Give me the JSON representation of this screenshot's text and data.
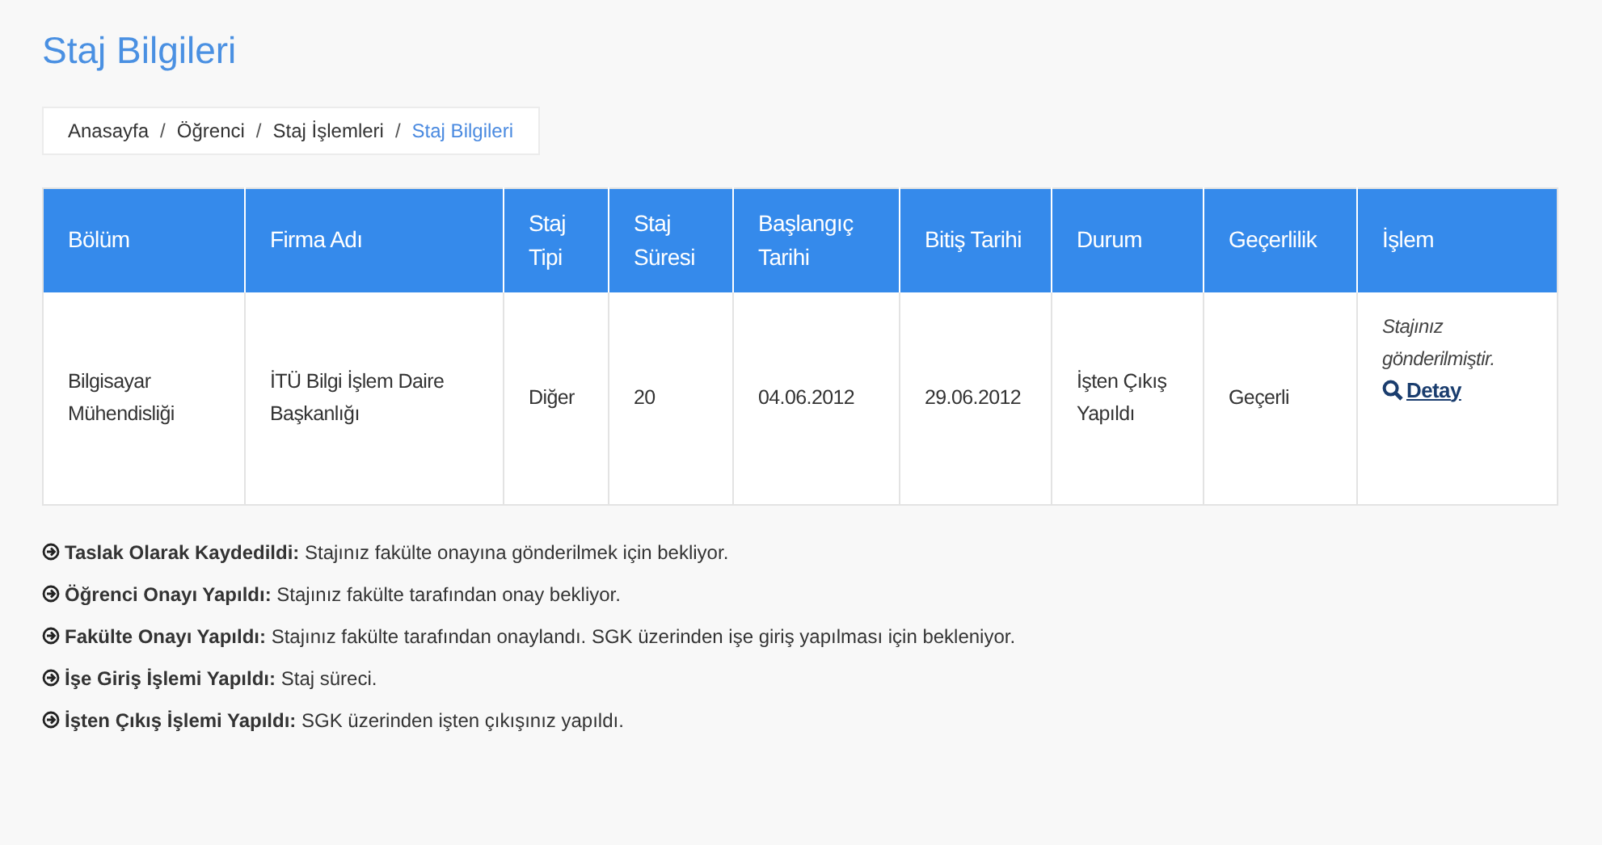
{
  "page_title": "Staj Bilgileri",
  "breadcrumb": [
    {
      "label": "Anasayfa",
      "selected": false
    },
    {
      "separator": "/",
      "label": "Öğrenci",
      "selected": false
    },
    {
      "separator": "/",
      "label": "Staj İşlemleri",
      "selected": false
    },
    {
      "separator": "/",
      "label": "Staj Bilgileri",
      "selected": true
    }
  ],
  "table": {
    "columns": [
      "Bölüm",
      "Firma Adı",
      "Staj Tipi",
      "Staj Süresi",
      "Başlangıç Tarihi",
      "Bitiş Tarihi",
      "Durum",
      "Geçerlilik",
      "İşlem"
    ],
    "rows": [
      {
        "cells": [
          "Bilgisayar Mühendisliği",
          "İTÜ Bilgi İşlem Daire Başkanlığı",
          "Diğer",
          "20",
          "04.06.2012",
          "29.06.2012",
          "İşten Çıkış Yapıldı",
          "Geçerli"
        ],
        "note": "Stajınız gönderilmiştir.",
        "action": "Detay"
      }
    ]
  },
  "legend": [
    "**Taslak Olarak Kaydedildi:** Stajınız fakülte onayına gönderilmek için bekliyor.",
    "**Öğrenci Onayı Yapıldı:** Stajınız fakülte tarafından onay bekliyor.",
    "**Fakülte Onayı Yapıldı:** Stajınız fakülte tarafından onaylandı. SGK üzerinden işe giriş yapılması için bekleniyor.",
    "**İşe Giriş İşlemi Yapıldı:** Staj süreci.",
    "**İşten Çıkış İşlemi Yapıldı:** SGK üzerinden işten çıkışınız yapıldı."
  ]
}
